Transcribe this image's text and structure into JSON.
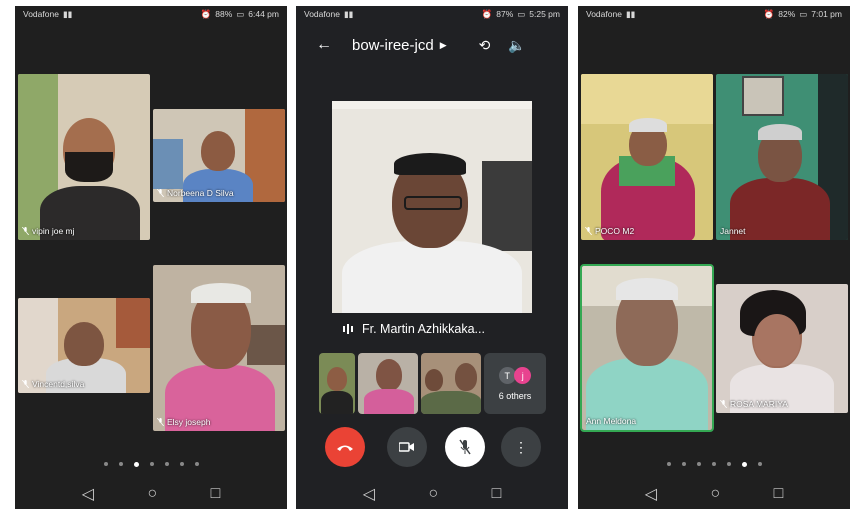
{
  "phone1": {
    "status": {
      "carrier": "Vodafone",
      "battery": "88%",
      "time": "6:44 pm"
    },
    "tiles": [
      {
        "name": "vipin joe mj"
      },
      {
        "name": "Norbeena D Silva"
      },
      {
        "name": "Vincentd,silva"
      },
      {
        "name": "Elsy joseph"
      }
    ]
  },
  "phone2": {
    "status": {
      "carrier": "Vodafone",
      "battery": "87%",
      "time": "5:25 pm"
    },
    "meeting_code": "bow-iree-jcd",
    "speaker_name": "Fr. Martin Azhikkaka...",
    "others": {
      "avatars": [
        "T",
        "j"
      ],
      "label": "6 others"
    }
  },
  "phone3": {
    "status": {
      "carrier": "Vodafone",
      "battery": "82%",
      "time": "7:01 pm"
    },
    "tiles": [
      {
        "name": "POCO M2"
      },
      {
        "name": "Jannet"
      },
      {
        "name": "Ann Meldona"
      },
      {
        "name": "ROSA MARIYA"
      }
    ]
  },
  "colors": {
    "end_call": "#ea4335",
    "active_speaker": "#34a853",
    "avatar_t": "#5f6368",
    "avatar_j": "#e8438f"
  }
}
